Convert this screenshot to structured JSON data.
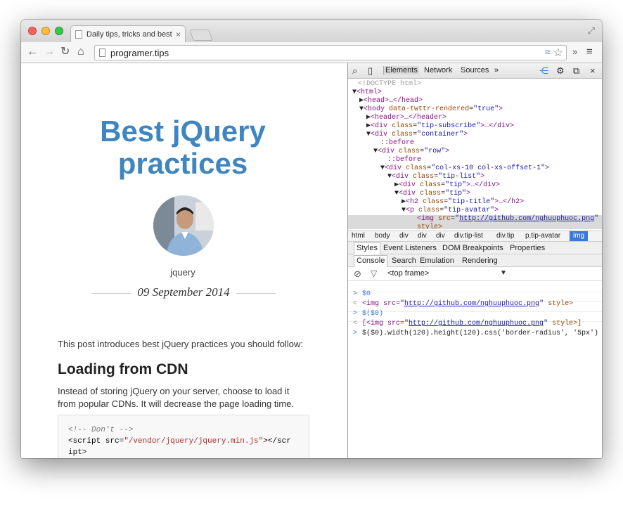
{
  "browser": {
    "tab_title": "Daily tips, tricks and best",
    "tab_close": "×",
    "url": "programer.tips"
  },
  "page": {
    "title_line1": "Best jQuery",
    "title_line2": "practices",
    "category": "jquery",
    "date": "09 September 2014",
    "intro": "This post introduces best jQuery practices you should follow:",
    "section_heading": "Loading from CDN",
    "paragraph_line1": "Instead of storing jQuery on your server, choose to load it",
    "paragraph_line2": "from popular CDNs. It will decrease the page loading time.",
    "code": {
      "comment": "<!-- Don't -->",
      "script_open": "<script src=",
      "script_src": "\"/vendor/jquery/jquery.min.js\"",
      "script_close_a": "></scr",
      "script_close_b": "ipt>"
    }
  },
  "devtools": {
    "panels": [
      "Elements",
      "Network",
      "Sources"
    ],
    "more_panels": "»",
    "dom": {
      "doctype": "<!DOCTYPE html>",
      "html": "<html>",
      "head": "<head>…</head>",
      "body_tag": "<body",
      "body_attr": "data-twttr-rendered",
      "body_val": "\"true\"",
      "header": "<header>…</header>",
      "div_subscribe_attr": "class",
      "div_subscribe_val": "\"tip-subscribe\"",
      "div_container_val": "\"container\"",
      "before": "::before",
      "div_row_val": "\"row\"",
      "div_col_val": "\"col-xs-10 col-xs-offset-1\"",
      "div_tiplist_val": "\"tip-list\"",
      "div_tip_val": "\"tip\"",
      "h2_val": "\"tip-title\"",
      "p_val": "\"tip-avatar\"",
      "img_src": "http://github.com/nghuuphuoc.png",
      "img_style": "style>"
    },
    "breadcrumbs": [
      "html",
      "body",
      "div",
      "div",
      "div",
      "div.tip-list",
      "div.tip",
      "p.tip-avatar",
      "img"
    ],
    "sidebar_tabs": [
      "Styles",
      "Event Listeners",
      "DOM Breakpoints",
      "Properties"
    ],
    "drawer_tabs": [
      "Console",
      "Search",
      "Emulation",
      "Rendering"
    ],
    "frame_selector": "<top frame>",
    "console": {
      "l1": "$0",
      "l2_img": "<img src=",
      "l2_src": "http://github.com/nghuuphuoc.png",
      "l2_style": " style>",
      "l3": "$($0)",
      "l4_pre": "[<img src=",
      "l4_src": "http://github.com/nghuuphuoc.png",
      "l4_post": " style>]",
      "l5": "$($0).width(120).height(120).css('border-radius', '5px')"
    }
  }
}
